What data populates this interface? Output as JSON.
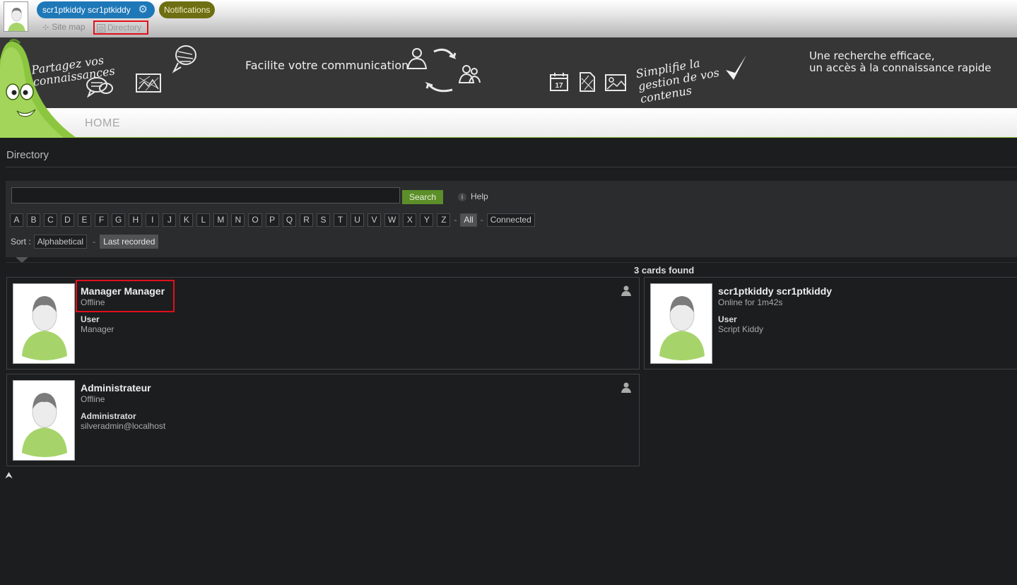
{
  "topbar": {
    "user_name": "scr1ptkiddy scr1ptkiddy",
    "notifications_label": "Notifications",
    "sitemap_label": "Site map",
    "directory_label": "Directory"
  },
  "banner": {
    "text1": "Partagez vos connaissances",
    "text2": "Facilite votre communication",
    "text3": "Simplifie la gestion de vos contenus",
    "text4_line1": "Une recherche efficace,",
    "text4_line2": "un accès à la connaissance rapide",
    "calendar_day": "17"
  },
  "nav": {
    "home_label": "HOME"
  },
  "page": {
    "title": "Directory"
  },
  "search": {
    "input_value": "",
    "button_label": "Search",
    "help_label": "Help",
    "letters": [
      "A",
      "B",
      "C",
      "D",
      "E",
      "F",
      "G",
      "H",
      "I",
      "J",
      "K",
      "L",
      "M",
      "N",
      "O",
      "P",
      "Q",
      "R",
      "S",
      "T",
      "U",
      "V",
      "W",
      "X",
      "Y",
      "Z"
    ],
    "all_label": "All",
    "connected_label": "Connected",
    "sort_label": "Sort :",
    "sort_alphabetical": "Alphabetical",
    "sort_last_recorded": "Last recorded"
  },
  "results": {
    "count_text": "3 cards found",
    "cards": [
      {
        "name": "Manager Manager",
        "status": "Offline",
        "role": "User",
        "detail": "Manager"
      },
      {
        "name": "scr1ptkiddy scr1ptkiddy",
        "status": "Online for 1m42s",
        "role": "User",
        "detail": "Script Kiddy"
      },
      {
        "name": "Administrateur",
        "status": "Offline",
        "role": "Administrator",
        "detail": "silveradmin@localhost"
      }
    ]
  },
  "colors": {
    "accent_blue": "#1e78b8",
    "accent_green": "#5c8e2a",
    "highlight_red": "#e0101a",
    "background": "#1c1d1f"
  }
}
